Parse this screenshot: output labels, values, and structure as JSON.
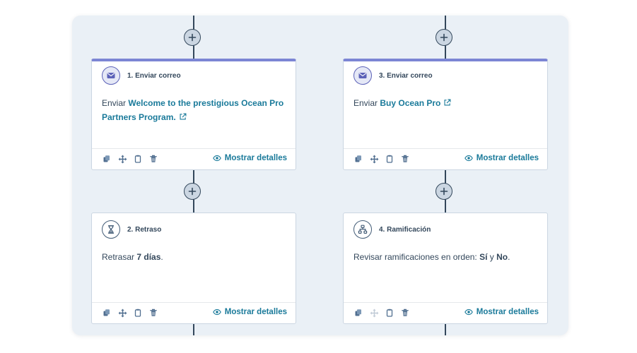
{
  "steps": [
    {
      "title": "1. Enviar correo",
      "prefix": "Enviar",
      "link": "Welcome to the prestigious Ocean Pro Partners Program.",
      "details": "Mostrar detalles"
    },
    {
      "title": "2. Retraso",
      "prefix": "Retrasar",
      "value": "7 días",
      "suffix": ".",
      "details": "Mostrar detalles"
    },
    {
      "title": "3. Enviar correo",
      "prefix": "Enviar",
      "link": "Buy Ocean Pro",
      "details": "Mostrar detalles"
    },
    {
      "title": "4. Ramificación",
      "prefix": "Revisar ramificaciones en orden:",
      "branch_a": "Sí",
      "conj": "y",
      "branch_b": "No",
      "suffix": ".",
      "details": "Mostrar detalles"
    }
  ],
  "icons": {
    "email": "envelope-icon",
    "delay": "hourglass-icon",
    "branch": "branch-icon",
    "add": "plus-icon",
    "external": "external-link-icon",
    "copy": "copy-icon",
    "move": "move-icon",
    "clipboard": "clipboard-icon",
    "delete": "trash-icon",
    "view": "eye-icon"
  },
  "colors": {
    "canvas": "#eaf0f6",
    "accent_bar": "#7c85d4",
    "link": "#1a7a9a",
    "text": "#33475b",
    "border": "#cbd6e2"
  }
}
